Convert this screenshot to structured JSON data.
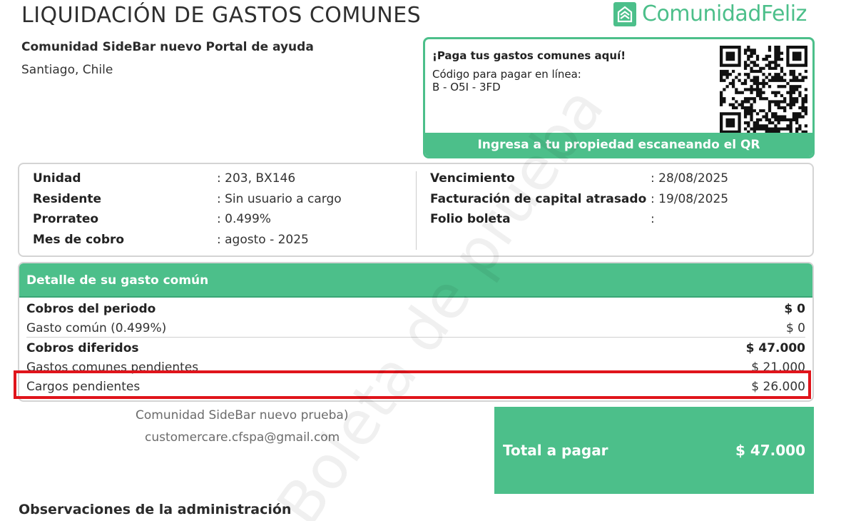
{
  "header": {
    "title": "LIQUIDACIÓN DE GASTOS COMUNES",
    "brand": "ComunidadFeliz"
  },
  "community": {
    "name": "Comunidad SideBar nuevo Portal de ayuda",
    "city": "Santiago, Chile"
  },
  "payment": {
    "title": "¡Paga tus gastos comunes aquí!",
    "code_label": "Código para pagar en línea:",
    "code": "B - O5I - 3FD",
    "footer": "Ingresa a tu propiedad escaneando el QR"
  },
  "info": {
    "left": [
      {
        "label": "Unidad",
        "value": ": 203, BX146"
      },
      {
        "label": "Residente",
        "value": ": Sin usuario a cargo"
      },
      {
        "label": "Prorrateo",
        "value": ": 0.499%"
      },
      {
        "label": "Mes de cobro",
        "value": ": agosto - 2025"
      }
    ],
    "right": [
      {
        "label": "Vencimiento",
        "value": ": 28/08/2025"
      },
      {
        "label": "Facturación de capital atrasado",
        "value": ": 19/08/2025"
      },
      {
        "label": "Folio boleta",
        "value": ":"
      }
    ]
  },
  "detail": {
    "header": "Detalle de su gasto común",
    "rows": [
      {
        "label": "Cobros del periodo",
        "amount": "$ 0"
      },
      {
        "label": "Gasto común (0.499%)",
        "amount": "$ 0"
      },
      {
        "label": "Cobros diferidos",
        "amount": "$ 47.000"
      },
      {
        "label": "Gastos comunes pendientes",
        "amount": "$ 21.000"
      },
      {
        "label": "Cargos pendientes",
        "amount": "$ 26.000"
      }
    ]
  },
  "footer": {
    "org": "Comunidad SideBar nuevo prueba)",
    "email": "customercare.cfspa@gmail.com"
  },
  "total": {
    "label": "Total a pagar",
    "amount": "$ 47.000"
  },
  "observations_title": "Observaciones de la administración",
  "watermark": "Boleta de prueba",
  "colors": {
    "accent": "#4cbf8a",
    "highlight": "#e0141b"
  }
}
